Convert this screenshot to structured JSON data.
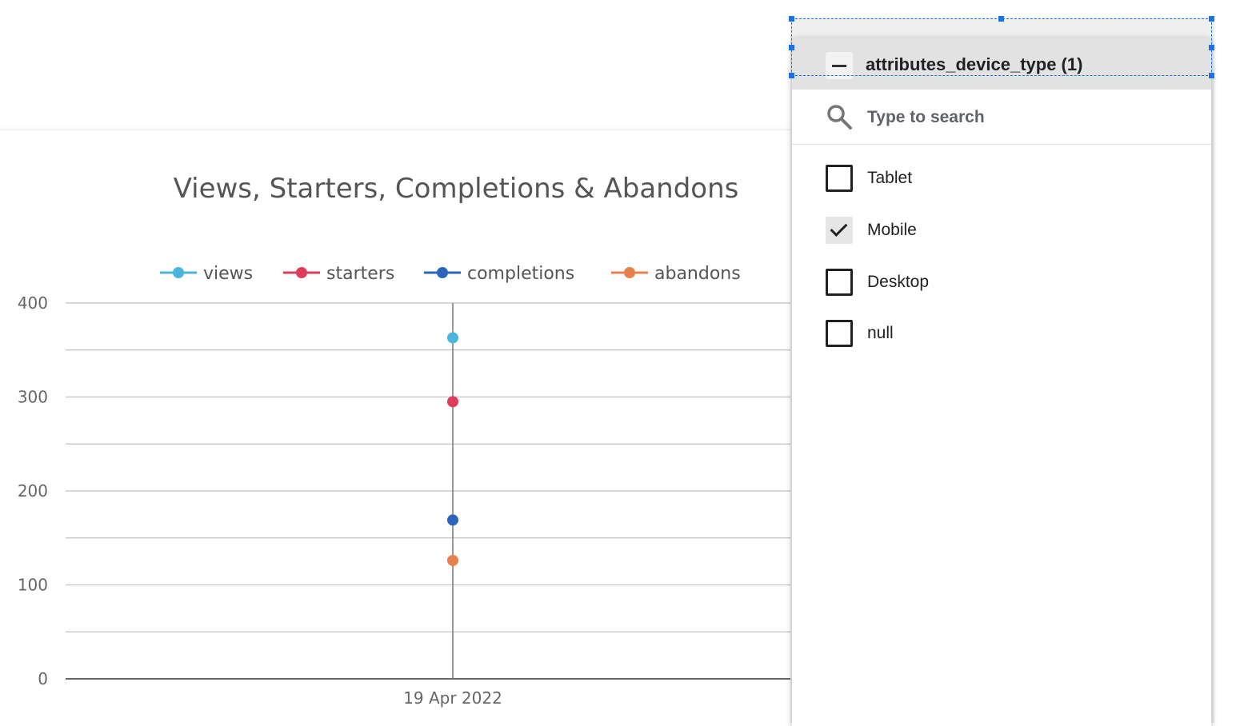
{
  "chart_data": {
    "type": "line",
    "title": "Views, Starters, Completions & Abandons",
    "xlabel": "",
    "ylabel": "",
    "categories": [
      "19 Apr 2022"
    ],
    "ylim": [
      0,
      400
    ],
    "yticks": [
      "0",
      "100",
      "200",
      "300",
      "400"
    ],
    "grid": true,
    "legend_position": "top",
    "series": [
      {
        "name": "views",
        "values": [
          363
        ],
        "color": "#4ab4dc"
      },
      {
        "name": "starters",
        "values": [
          295
        ],
        "color": "#dc3d5a"
      },
      {
        "name": "completions",
        "values": [
          169
        ],
        "color": "#2a64be"
      },
      {
        "name": "abandons",
        "values": [
          126
        ],
        "color": "#e8804e"
      }
    ]
  },
  "filter": {
    "title": "attributes_device_type (1)",
    "search_placeholder": "Type to search",
    "options": [
      {
        "label": "Tablet",
        "checked": false
      },
      {
        "label": "Mobile",
        "checked": true
      },
      {
        "label": "Desktop",
        "checked": false
      },
      {
        "label": "null",
        "checked": false
      }
    ],
    "icons": {
      "collapse": "minus-icon",
      "search": "search-icon",
      "check": "check-icon"
    },
    "colors": {
      "header_bg": "#e2e2e2",
      "selection": "#1a73e8"
    }
  }
}
